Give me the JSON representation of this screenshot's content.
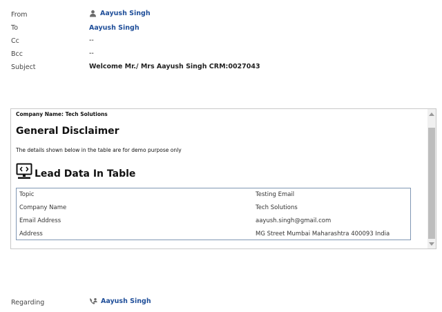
{
  "header": {
    "from": {
      "label": "From",
      "value": "Aayush Singh"
    },
    "to": {
      "label": "To",
      "value": "Aayush Singh"
    },
    "cc": {
      "label": "Cc",
      "value": "--"
    },
    "bcc": {
      "label": "Bcc",
      "value": "--"
    },
    "subject": {
      "label": "Subject",
      "value": "Welcome Mr./ Mrs Aayush Singh CRM:0027043"
    }
  },
  "email_body": {
    "company_name": "Company Name: Tech Solutions",
    "disclaimer_heading": "General Disclaimer",
    "disclaimer_text": "The details shown below in the table are for demo purpose only",
    "lead_heading": "Lead Data In Table",
    "lead_icon": "computer-icon",
    "table": [
      {
        "key": "Topic",
        "value": "Testing Email"
      },
      {
        "key": "Company Name",
        "value": "Tech Solutions"
      },
      {
        "key": "Email Address",
        "value": "aayush.singh@gmail.com"
      },
      {
        "key": "Address",
        "value": "MG Street Mumbai Maharashtra 400093 India"
      }
    ]
  },
  "regarding": {
    "label": "Regarding",
    "value": "Aayush Singh",
    "icon": "contact-icon"
  },
  "icons": {
    "from_icon": "user-icon"
  },
  "colors": {
    "link": "#1f4e99",
    "table_border": "#7f96b3",
    "scroll_thumb": "#bdbdbd"
  }
}
